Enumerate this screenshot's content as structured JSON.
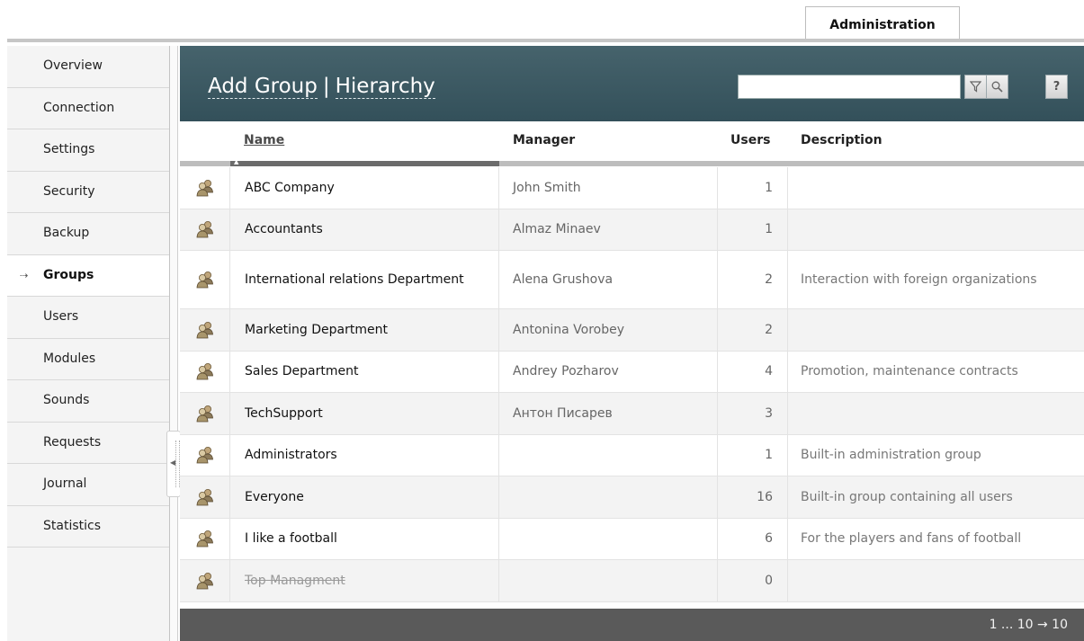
{
  "top_tab": {
    "label": "Administration"
  },
  "sidebar": {
    "items": [
      {
        "label": "Overview"
      },
      {
        "label": "Connection"
      },
      {
        "label": "Settings"
      },
      {
        "label": "Security"
      },
      {
        "label": "Backup"
      },
      {
        "label": "Groups",
        "active": true
      },
      {
        "label": "Users"
      },
      {
        "label": "Modules"
      },
      {
        "label": "Sounds"
      },
      {
        "label": "Requests"
      },
      {
        "label": "Journal"
      },
      {
        "label": "Statistics"
      }
    ]
  },
  "header": {
    "add_group_label": "Add Group",
    "separator": "|",
    "hierarchy_label": "Hierarchy",
    "search_value": "",
    "help_label": "?"
  },
  "table": {
    "columns": {
      "name": "Name",
      "manager": "Manager",
      "users": "Users",
      "description": "Description"
    },
    "sorted_by": "Name",
    "rows": [
      {
        "name": "ABC Company",
        "manager": "John Smith",
        "users": "1",
        "description": ""
      },
      {
        "name": "Accountants",
        "manager": "Almaz Minaev",
        "users": "1",
        "description": ""
      },
      {
        "name": "International relations Department",
        "manager": "Alena Grushova",
        "users": "2",
        "description": "Interaction with foreign organizations"
      },
      {
        "name": "Marketing Department",
        "manager": "Antonina Vorobey",
        "users": "2",
        "description": ""
      },
      {
        "name": "Sales Department",
        "manager": "Andrey Pozharov",
        "users": "4",
        "description": "Promotion, maintenance contracts"
      },
      {
        "name": "TechSupport",
        "manager": "Антон Писарев",
        "users": "3",
        "description": ""
      },
      {
        "name": "Administrators",
        "manager": "",
        "users": "1",
        "description": "Built-in administration group"
      },
      {
        "name": "Everyone",
        "manager": "",
        "users": "16",
        "description": "Built-in group containing all users"
      },
      {
        "name": "I like a football",
        "manager": "",
        "users": "6",
        "description": "For the players and fans of football"
      },
      {
        "name": "Top Managment",
        "manager": "",
        "users": "0",
        "description": "",
        "disabled": true
      }
    ]
  },
  "footer": {
    "pager": "1 ... 10 → 10"
  },
  "colors": {
    "header_bg": "#3d5a63",
    "footer_bg": "#5a5a5a",
    "row_alt": "#f3f3f3",
    "sidebar_bg": "#f4f4f4"
  },
  "icons": {
    "row_icon": "group-icon",
    "filter": "filter-icon",
    "search": "search-icon"
  }
}
